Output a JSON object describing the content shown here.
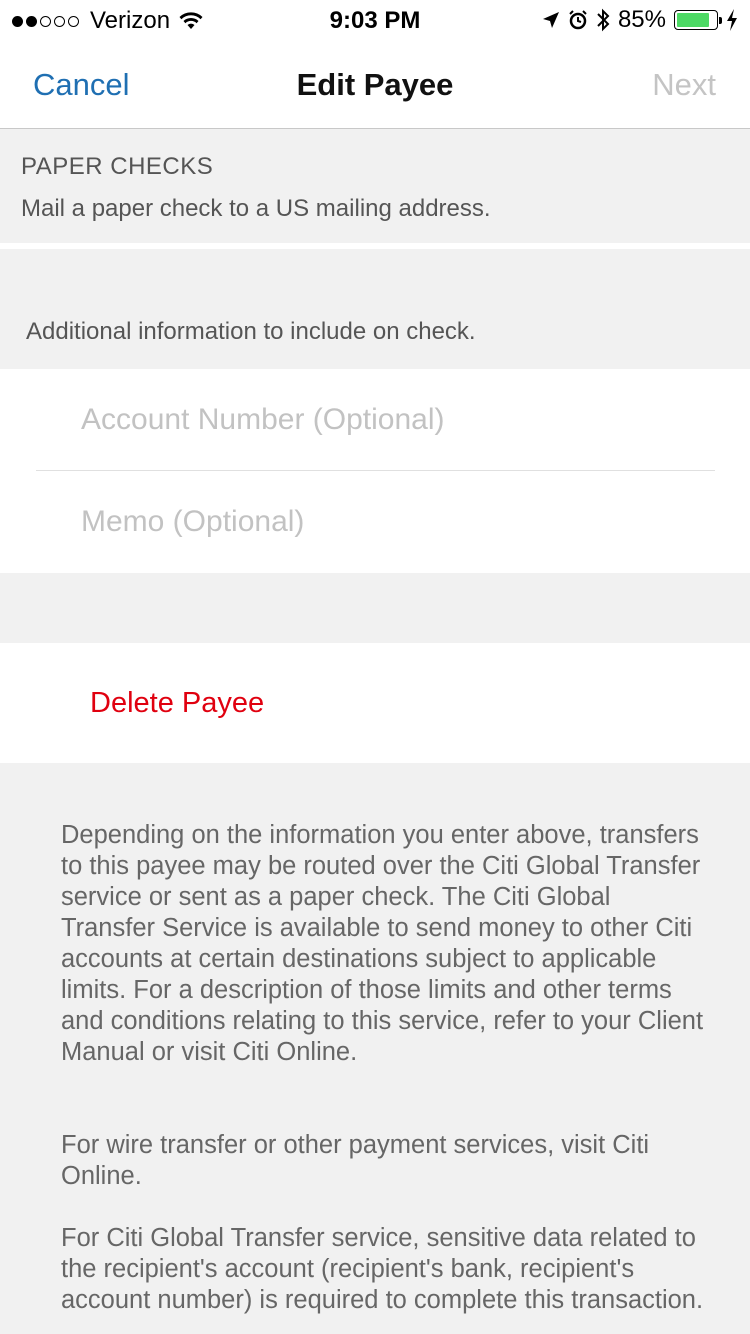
{
  "status_bar": {
    "carrier": "Verizon",
    "signal_bars_filled": 2,
    "signal_bars_total": 5,
    "time": "9:03 PM",
    "battery_percent_label": "85%",
    "battery_level": 0.85,
    "battery_color": "#4cd964",
    "icons": [
      "wifi-icon",
      "location-arrow-icon",
      "alarm-icon",
      "bluetooth-icon",
      "battery-icon",
      "charging-bolt-icon"
    ]
  },
  "nav": {
    "cancel_label": "Cancel",
    "title": "Edit Payee",
    "next_label": "Next"
  },
  "section": {
    "title": "PAPER CHECKS",
    "subtitle": "Mail a paper check to a US mailing address."
  },
  "info": {
    "text": "Additional information to include on check."
  },
  "fields": {
    "account_number_placeholder": "Account Number (Optional)",
    "memo_placeholder": "Memo (Optional)"
  },
  "delete": {
    "label": "Delete Payee",
    "color": "#e0000f"
  },
  "disclaimer": {
    "paragraph1": "Depending on the information you enter above, transfers to this payee may be routed over the Citi Global Transfer service or sent as a paper check. The Citi Global Transfer Service is available to send money to other Citi accounts at certain destinations subject to applicable limits. For a description of those limits and other terms and conditions relating to this service, refer to your Client Manual or visit Citi Online.",
    "paragraph2": "For wire transfer or other payment services, visit Citi Online.",
    "paragraph3": "For Citi Global Transfer service, sensitive data related to the recipient's account (recipient's bank, recipient's account number) is required to complete this transaction."
  },
  "colors": {
    "link_blue": "#1f6fb2",
    "disabled_gray": "#c4c4c4",
    "background_gray": "#f1f1f1"
  }
}
